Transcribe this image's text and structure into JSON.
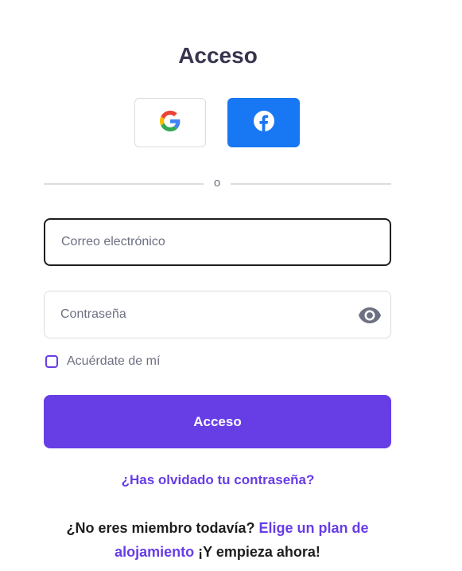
{
  "title": "Acceso",
  "social": {
    "google_icon": "google-icon",
    "facebook_icon": "facebook-icon",
    "google_color": "#ffffff",
    "facebook_color": "#1877f2"
  },
  "divider": {
    "text": "o"
  },
  "email": {
    "placeholder": "Correo electrónico",
    "value": ""
  },
  "password": {
    "placeholder": "Contraseña",
    "value": "",
    "toggle_icon": "eye-icon"
  },
  "remember": {
    "label": "Acuérdate de mí",
    "checked": false
  },
  "submit_label": "Acceso",
  "forgot_label": "¿Has olvidado tu contraseña?",
  "signup": {
    "prefix": "¿No eres miembro todavía?",
    "link": "Elige un plan de alojamiento",
    "suffix": "¡Y empieza ahora!"
  },
  "colors": {
    "accent": "#673de6",
    "text": "#36344d",
    "muted": "#6d7081",
    "border": "#dadce0"
  }
}
